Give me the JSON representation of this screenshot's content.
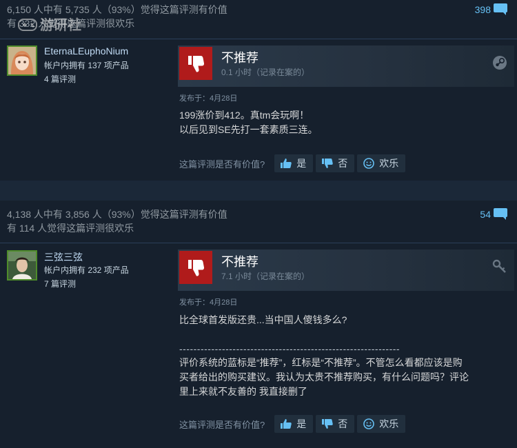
{
  "reviews": [
    {
      "helpful_line1": "6,150 人中有 5,735 人（93%）觉得这篇评测有价值",
      "helpful_line2": "有 332 人觉得这篇评测很欢乐",
      "comment_count": "398",
      "author_name": "EternaLEuphoNium",
      "products_owned": "帐户内拥有 137 项产品",
      "review_count": "4 篇评测",
      "verdict": "不推荐",
      "hours": "0.1 小时（记录在案的）",
      "header_icon": "steam-icon",
      "posted": "发布于：4月28日",
      "body_lines": [
        "199涨价到412。真tm会玩啊！",
        "以后见到SE先打一套素质三连。"
      ],
      "separator": "",
      "body_extra": [],
      "vote_prompt": "这篇评测是否有价值?",
      "vote_yes": "是",
      "vote_no": "否",
      "vote_funny": "欢乐"
    },
    {
      "helpful_line1": "4,138 人中有 3,856 人（93%）觉得这篇评测有价值",
      "helpful_line2": "有 114 人觉得这篇评测很欢乐",
      "comment_count": "54",
      "author_name": "三弦三弦",
      "products_owned": "帐户内拥有 232 项产品",
      "review_count": "7 篇评测",
      "verdict": "不推荐",
      "hours": "7.1 小时（记录在案的）",
      "header_icon": "key-icon",
      "posted": "发布于：4月28日",
      "body_lines": [
        "比全球首发版还贵...当中国人傻钱多么?"
      ],
      "separator": "--------------------------------------------------------------",
      "body_extra": [
        "评价系统的蓝标是“推荐”，红标是“不推荐”。不管怎么看都应该是购",
        "买者给出的购买建议。我认为太贵不推荐购买，有什么问题吗？评论",
        "里上来就不友善的 我直接删了"
      ],
      "vote_prompt": "这篇评测是否有价值?",
      "vote_yes": "是",
      "vote_no": "否",
      "vote_funny": "欢乐"
    }
  ],
  "watermark": "游研社",
  "colors": {
    "background": "#1b2838",
    "card": "#16202d",
    "not_recommended": "#b01b1b",
    "link": "#66c0f4"
  }
}
